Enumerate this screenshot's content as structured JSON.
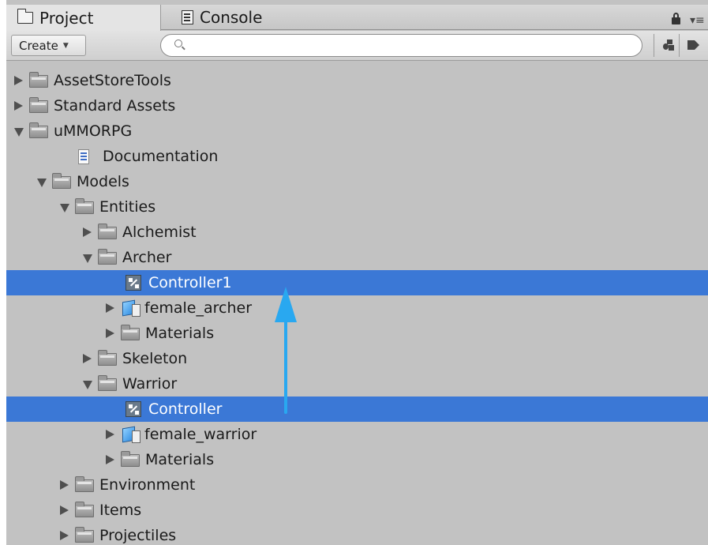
{
  "tabs": [
    {
      "label": "Project",
      "icon": "folder-icon"
    },
    {
      "label": "Console",
      "icon": "console-icon"
    }
  ],
  "toolbar": {
    "create_label": "Create",
    "create_caret": "▼",
    "search_placeholder": "",
    "menu_glyph": "▾≡"
  },
  "tree": [
    {
      "name": "folder-assetstoretools",
      "label": "AssetStoreTools",
      "depth": 0,
      "arrow": "collapsed",
      "icon": "folder",
      "selected": false
    },
    {
      "name": "folder-standard-assets",
      "label": "Standard Assets",
      "depth": 0,
      "arrow": "collapsed",
      "icon": "folder",
      "selected": false
    },
    {
      "name": "folder-ummorpg",
      "label": "uMMORPG",
      "depth": 0,
      "arrow": "expanded",
      "icon": "folder",
      "selected": false
    },
    {
      "name": "file-documentation",
      "label": "Documentation",
      "depth": 1,
      "arrow": "none",
      "icon": "document",
      "selected": false
    },
    {
      "name": "folder-models",
      "label": "Models",
      "depth": 1,
      "arrow": "expanded",
      "icon": "folder",
      "selected": false
    },
    {
      "name": "folder-entities",
      "label": "Entities",
      "depth": 2,
      "arrow": "expanded",
      "icon": "folder",
      "selected": false
    },
    {
      "name": "folder-alchemist",
      "label": "Alchemist",
      "depth": 3,
      "arrow": "collapsed",
      "icon": "folder",
      "selected": false
    },
    {
      "name": "folder-archer",
      "label": "Archer",
      "depth": 3,
      "arrow": "expanded",
      "icon": "folder",
      "selected": false
    },
    {
      "name": "asset-controller1",
      "label": "Controller1",
      "depth": 4,
      "arrow": "none",
      "icon": "controller",
      "selected": true
    },
    {
      "name": "asset-female-archer",
      "label": "female_archer",
      "depth": 4,
      "arrow": "collapsed",
      "icon": "model",
      "selected": false
    },
    {
      "name": "folder-archer-materials",
      "label": "Materials",
      "depth": 4,
      "arrow": "collapsed",
      "icon": "folder",
      "selected": false
    },
    {
      "name": "folder-skeleton",
      "label": "Skeleton",
      "depth": 3,
      "arrow": "collapsed",
      "icon": "folder",
      "selected": false
    },
    {
      "name": "folder-warrior",
      "label": "Warrior",
      "depth": 3,
      "arrow": "expanded",
      "icon": "folder",
      "selected": false
    },
    {
      "name": "asset-controller",
      "label": "Controller",
      "depth": 4,
      "arrow": "none",
      "icon": "controller",
      "selected": true
    },
    {
      "name": "asset-female-warrior",
      "label": "female_warrior",
      "depth": 4,
      "arrow": "collapsed",
      "icon": "model",
      "selected": false
    },
    {
      "name": "folder-warrior-materials",
      "label": "Materials",
      "depth": 4,
      "arrow": "collapsed",
      "icon": "folder",
      "selected": false
    },
    {
      "name": "folder-environment",
      "label": "Environment",
      "depth": 2,
      "arrow": "collapsed",
      "icon": "folder",
      "selected": false
    },
    {
      "name": "folder-items",
      "label": "Items",
      "depth": 2,
      "arrow": "collapsed",
      "icon": "folder",
      "selected": false
    },
    {
      "name": "folder-projectiles",
      "label": "Projectiles",
      "depth": 2,
      "arrow": "collapsed",
      "icon": "folder",
      "selected": false
    }
  ],
  "colors": {
    "selection": "#3b78d6",
    "panel": "#c2c2c2",
    "annotation_arrow": "#29a8f0"
  }
}
